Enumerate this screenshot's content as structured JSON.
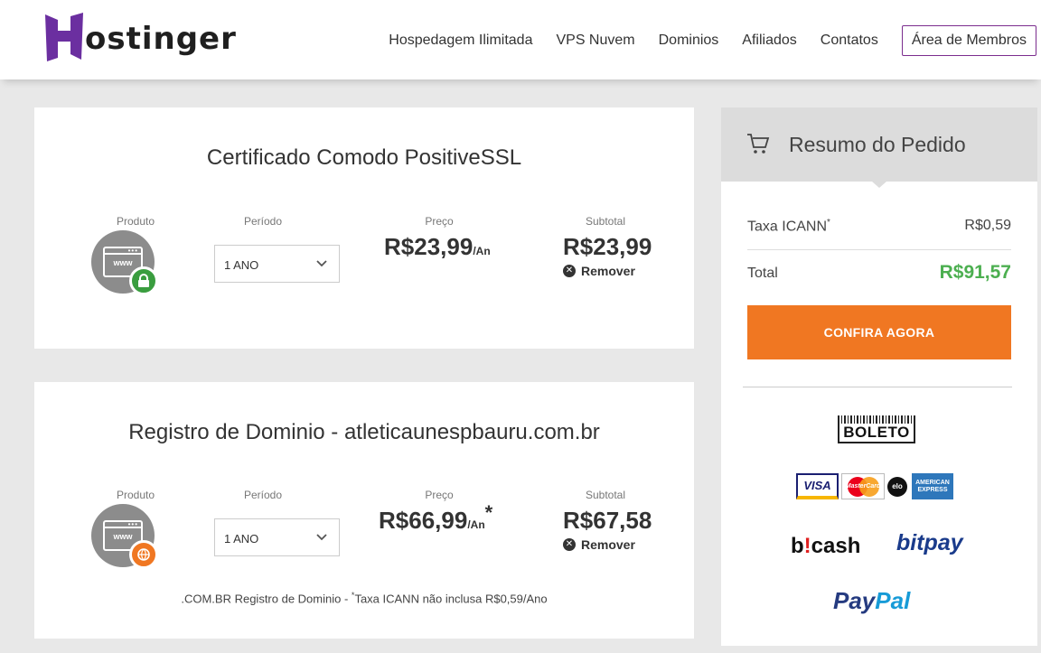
{
  "header": {
    "logo_text": "ostinger",
    "nav": [
      "Hospedagem Ilimitada",
      "VPS Nuvem",
      "Dominios",
      "Afiliados",
      "Contatos"
    ],
    "members_button": "Área de Membros"
  },
  "products": [
    {
      "title": "Certificado Comodo PositiveSSL",
      "product_label": "Produto",
      "period_label": "Período",
      "price_label": "Preço",
      "subtotal_label": "Subtotal",
      "icon_text": "www",
      "period_value": "1 ANO",
      "price": "R$23,99",
      "price_unit": "/An",
      "subtotal": "R$23,99",
      "remove": "Remover"
    },
    {
      "title": "Registro de Dominio - atleticaunespbauru.com.br",
      "product_label": "Produto",
      "period_label": "Período",
      "price_label": "Preço",
      "subtotal_label": "Subtotal",
      "icon_text": "www",
      "period_value": "1 ANO",
      "price": "R$66,99",
      "price_unit": "/An",
      "price_mark": "*",
      "subtotal": "R$67,58",
      "remove": "Remover",
      "note_prefix": ".COM.BR Registro de Dominio - ",
      "note_mark": "*",
      "note_suffix": "Taxa ICANN não inclusa R$0,59/Ano"
    }
  ],
  "summary": {
    "title": "Resumo do Pedido",
    "icann_label": "Taxa ICANN",
    "icann_mark": "*",
    "icann_value": "R$0,59",
    "total_label": "Total",
    "total_value": "R$91,57",
    "cta": "CONFIRA AGORA",
    "payments": {
      "boleto": "BOLETO",
      "visa": "VISA",
      "mastercard": "MasterCard",
      "elo": "elo",
      "amex": "AMERICAN EXPRESS",
      "bcash_b": "b",
      "bcash_mark": "!",
      "bcash_rest": "cash",
      "bitpay": "bitpay",
      "paypal_1": "Pay",
      "paypal_2": "Pal"
    }
  },
  "colors": {
    "brand_purple": "#6b2fa0",
    "accent_orange": "#f07722",
    "total_green": "#4caf50"
  },
  "icons": [
    "lock-icon",
    "globe-icon",
    "cart-icon",
    "chevron-down-icon",
    "close-circle-icon"
  ]
}
